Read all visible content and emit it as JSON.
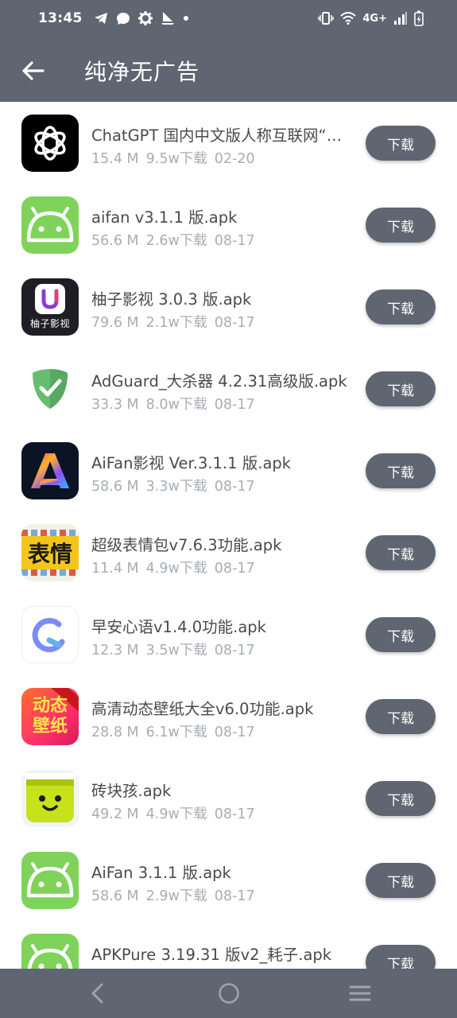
{
  "status_bar": {
    "time": "13:45",
    "network": "4G+"
  },
  "header": {
    "title": "纯净无广告"
  },
  "colors": {
    "primary": "#5f6672",
    "meta_text": "#a8adb4",
    "name_text": "#4a4a4a"
  },
  "apps": [
    {
      "name": "ChatGPT 国内中文版人称互联网“神器”.apk",
      "size": "15.4 M",
      "downloads": "9.5w下载",
      "date": "02-20",
      "button": "下载",
      "icon": "chatgpt-icon"
    },
    {
      "name": "aifan v3.1.1 版.apk",
      "size": "56.6 M",
      "downloads": "2.6w下载",
      "date": "08-17",
      "button": "下载",
      "icon": "android-icon"
    },
    {
      "name": "柚子影视 3.0.3 版.apk",
      "size": "79.6 M",
      "downloads": "2.1w下载",
      "date": "08-17",
      "button": "下载",
      "icon": "youzi-icon",
      "icon_text": "柚子影视"
    },
    {
      "name": "AdGuard_大杀器 4.2.31高级版.apk",
      "size": "33.3 M",
      "downloads": "8.0w下载",
      "date": "08-17",
      "button": "下载",
      "icon": "adguard-shield-icon"
    },
    {
      "name": "AiFan影视 Ver.3.1.1 版.apk",
      "size": "58.6 M",
      "downloads": "3.3w下载",
      "date": "08-17",
      "button": "下载",
      "icon": "aifan-a-icon"
    },
    {
      "name": "超级表情包v7.6.3功能.apk",
      "size": "11.4 M",
      "downloads": "4.9w下载",
      "date": "08-17",
      "button": "下载",
      "icon": "biaoqing-icon",
      "icon_text": "表情"
    },
    {
      "name": "早安心语v1.4.0功能.apk",
      "size": "12.3 M",
      "downloads": "3.5w下载",
      "date": "08-17",
      "button": "下载",
      "icon": "zaoan-ring-icon"
    },
    {
      "name": "高清动态壁纸大全v6.0功能.apk",
      "size": "28.8 M",
      "downloads": "6.1w下载",
      "date": "08-17",
      "button": "下载",
      "icon": "wallpaper-icon",
      "icon_text": "动态壁纸"
    },
    {
      "name": "砖块孩.apk",
      "size": "49.2 M",
      "downloads": "4.9w下载",
      "date": "08-17",
      "button": "下载",
      "icon": "smiley-block-icon"
    },
    {
      "name": "AiFan 3.1.1 版.apk",
      "size": "58.6 M",
      "downloads": "2.9w下载",
      "date": "08-17",
      "button": "下载",
      "icon": "android-icon"
    },
    {
      "name": "APKPure 3.19.31 版v2_耗子.apk",
      "size": "",
      "downloads": "下载",
      "date": "",
      "button": "下载",
      "icon": "android-icon"
    }
  ],
  "nav": {
    "back": "back-icon",
    "home": "home-icon",
    "menu": "menu-icon"
  }
}
